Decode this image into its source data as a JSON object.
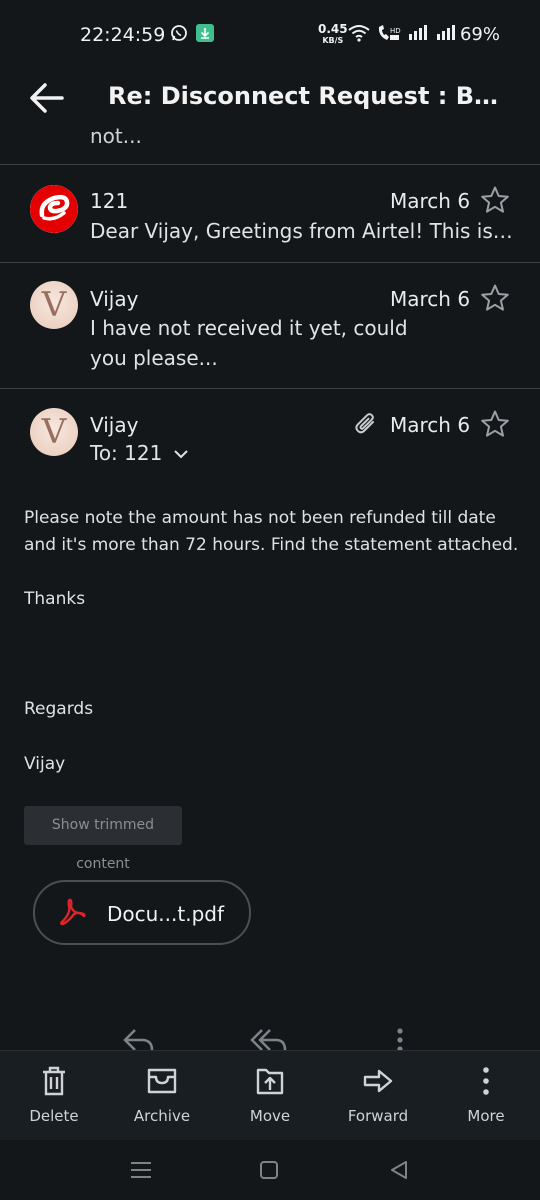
{
  "status_bar": {
    "time": "22:24:59",
    "speed_value": "0.45",
    "speed_unit": "KB/S",
    "battery": "69%",
    "icons": [
      "whatsapp-icon",
      "download-icon",
      "wifi-icon",
      "volte-call-icon",
      "signal-icon",
      "signal-icon"
    ]
  },
  "header": {
    "title": "Re: Disconnect Request : Broa...",
    "back_icon": "arrow-left-icon"
  },
  "thread": {
    "collapsed_top_text": "not...",
    "messages": [
      {
        "sender": "121",
        "date": "March 6",
        "snippet": "Dear Vijay, Greetings from Airtel! This is in...",
        "avatar": "airtel-logo"
      },
      {
        "sender": "Vijay",
        "date": "March 6",
        "snippet": "I have not received it yet, could you please...",
        "avatar_letter": "V"
      }
    ],
    "open_message": {
      "sender": "Vijay",
      "to_line": "To: 121",
      "date": "March 6",
      "avatar_letter": "V",
      "body_paragraph": "Please note the amount has not been refunded till date and it's more than 72 hours. Find the statement attached.",
      "thanks": "Thanks",
      "regards": "Regards",
      "signature": "Vijay",
      "show_trimmed_label": "Show trimmed content",
      "attachment_name": "Docu...t.pdf"
    }
  },
  "toolbar": {
    "items": [
      {
        "label": "Delete",
        "icon": "trash-icon"
      },
      {
        "label": "Archive",
        "icon": "archive-icon"
      },
      {
        "label": "Move",
        "icon": "move-icon"
      },
      {
        "label": "Forward",
        "icon": "forward-icon"
      },
      {
        "label": "More",
        "icon": "more-vertical-icon"
      }
    ]
  },
  "colors": {
    "background": "#13171a",
    "toolbar": "#191e22",
    "divider": "#3a3f44",
    "airtel_red": "#e40000",
    "pdf_red": "#e0242c"
  }
}
